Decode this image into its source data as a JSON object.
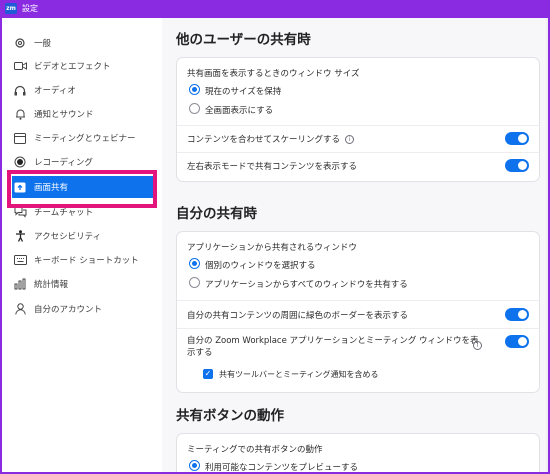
{
  "titlebar": {
    "app_icon": "zm",
    "title": "設定"
  },
  "sidebar": {
    "items": [
      {
        "label": "一般",
        "icon": "gear-icon"
      },
      {
        "label": "ビデオとエフェクト",
        "icon": "video-icon"
      },
      {
        "label": "オーディオ",
        "icon": "headphones-icon"
      },
      {
        "label": "通知とサウンド",
        "icon": "bell-icon"
      },
      {
        "label": "ミーティングとウェビナー",
        "icon": "calendar-icon"
      },
      {
        "label": "レコーディング",
        "icon": "record-icon"
      },
      {
        "label": "画面共有",
        "icon": "share-screen-icon",
        "active": true
      },
      {
        "label": "チームチャット",
        "icon": "chat-icon"
      },
      {
        "label": "アクセシビリティ",
        "icon": "accessibility-icon"
      },
      {
        "label": "キーボード ショートカット",
        "icon": "keyboard-icon"
      },
      {
        "label": "統計情報",
        "icon": "stats-icon"
      },
      {
        "label": "自分のアカウント",
        "icon": "account-icon"
      }
    ]
  },
  "sections": {
    "others": {
      "title": "他のユーザーの共有時",
      "window_size_label": "共有画面を表示するときのウィンドウ サイズ",
      "radio_keep": "現在のサイズを保持",
      "radio_full": "全画面表示にする",
      "scale_label": "コンテンツを合わせてスケーリングする",
      "side_by_side_label": "左右表示モードで共有コンテンツを表示する"
    },
    "mine": {
      "title": "自分の共有時",
      "app_window_label": "アプリケーションから共有されるウィンドウ",
      "radio_individual": "個別のウィンドウを選択する",
      "radio_all": "アプリケーションからすべてのウィンドウを共有する",
      "green_border_label": "自分の共有コンテンツの周囲に緑色のボーダーを表示する",
      "zoom_window_label_line1": "自分の Zoom Workplace アプリケーションとミーティング ウィンドウを表",
      "zoom_window_label_line2": "示する",
      "toolbar_checkbox_label": "共有ツールバーとミーティング通知を含める"
    },
    "share_button": {
      "title": "共有ボタンの動作",
      "meeting_label": "ミーティングでの共有ボタンの動作",
      "radio_preview": "利用可能なコンテンツをプレビューする"
    }
  },
  "colors": {
    "accent": "#0e72ed",
    "titlebar": "#8a2be2",
    "highlight": "#e4147d"
  }
}
